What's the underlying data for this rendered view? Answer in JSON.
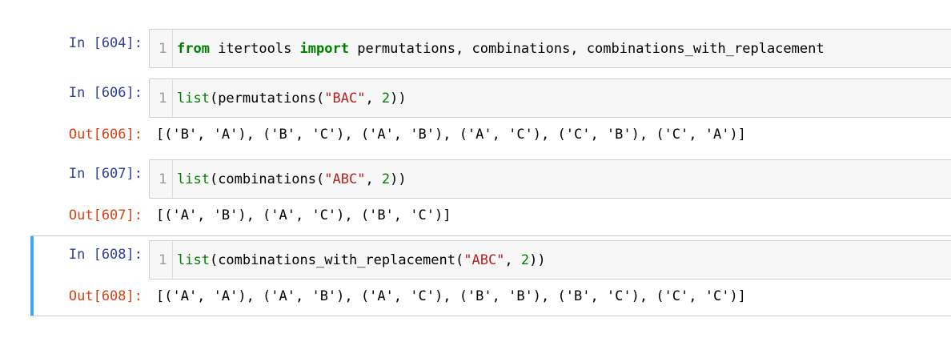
{
  "cells": [
    {
      "in_prompt": "In [604]:",
      "line_number": "1",
      "code": {
        "t1": "from",
        "t2": " itertools ",
        "t3": "import",
        "t4": " permutations, combinations, combinations_with_replacement"
      }
    },
    {
      "in_prompt": "In [606]:",
      "line_number": "1",
      "code": {
        "t1": "list",
        "t2": "(permutations(",
        "t3": "\"BAC\"",
        "t4": ", ",
        "t5": "2",
        "t6": "))"
      },
      "out_prompt": "Out[606]:",
      "output": "[('B', 'A'), ('B', 'C'), ('A', 'B'), ('A', 'C'), ('C', 'B'), ('C', 'A')]"
    },
    {
      "in_prompt": "In [607]:",
      "line_number": "1",
      "code": {
        "t1": "list",
        "t2": "(combinations(",
        "t3": "\"ABC\"",
        "t4": ", ",
        "t5": "2",
        "t6": "))"
      },
      "out_prompt": "Out[607]:",
      "output": "[('A', 'B'), ('A', 'C'), ('B', 'C')]"
    },
    {
      "in_prompt": "In [608]:",
      "line_number": "1",
      "code": {
        "t1": "list",
        "t2": "(combinations_with_replacement(",
        "t3": "\"ABC\"",
        "t4": ", ",
        "t5": "2",
        "t6": "))"
      },
      "out_prompt": "Out[608]:",
      "output": "[('A', 'A'), ('A', 'B'), ('A', 'C'), ('B', 'B'), ('B', 'C'), ('C', 'C')]"
    }
  ],
  "colors": {
    "in_prompt": "#303f9f",
    "out_prompt": "#d84315",
    "keyword": "#008000",
    "string": "#ba2121",
    "selected_cell_bar": "#42a5f5",
    "input_background": "#f7f7f7"
  }
}
